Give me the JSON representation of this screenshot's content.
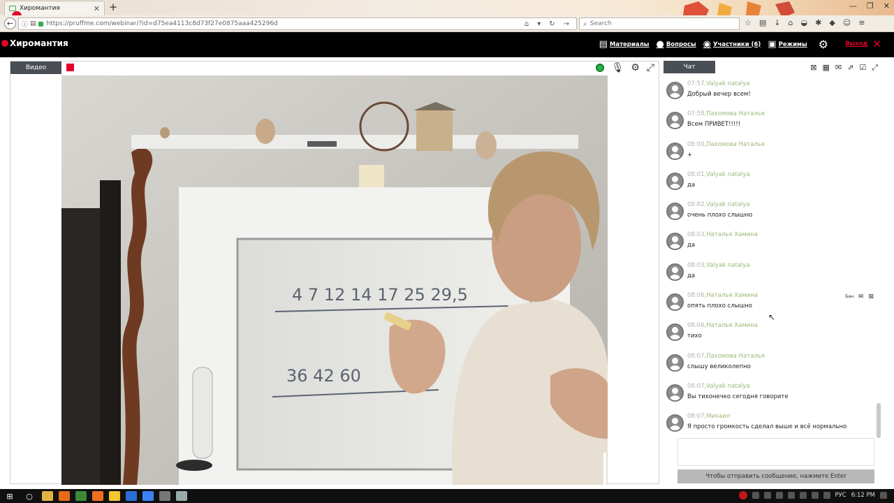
{
  "browser": {
    "tab_title": "Хиромантия",
    "tab_close": "✕",
    "new_tab": "+",
    "url": "https://pruffme.com/webinar/?id=d75ea4113c8d73f27e0875aaa425296d",
    "search_placeholder": "Search",
    "window_buttons": [
      "—",
      "❐",
      "✕"
    ]
  },
  "site": {
    "brand": "Хиромантия",
    "menu": [
      {
        "icon": "▤",
        "label": "Материалы"
      },
      {
        "icon": "●",
        "label": "Вопросы"
      },
      {
        "icon": "◉",
        "label": "Участники (6)"
      },
      {
        "icon": "▣",
        "label": "Режимы"
      }
    ],
    "settings_icon": "⚙",
    "logout_label": "Выход",
    "logout_icon": "✕"
  },
  "video": {
    "tab_label": "Видео",
    "board_row1": "4  7  12  14  17 25  29,5",
    "board_row2": "36  42  60"
  },
  "chat": {
    "tab_label": "Чат",
    "messages": [
      {
        "time": "07:57",
        "author": "Valyak natalya",
        "text": "Добрый вечер всем!"
      },
      {
        "time": "07:58",
        "author": "Пахомова Наталья",
        "text": "Всем ПРИВЕТ!!!!!"
      },
      {
        "time": "08:00",
        "author": "Пахомова Наталья",
        "text": "+"
      },
      {
        "time": "08:01",
        "author": "Valyak natalya",
        "text": "да"
      },
      {
        "time": "08:02",
        "author": "Valyak natalya",
        "text": "очень плохо слышно"
      },
      {
        "time": "08:03",
        "author": "Наталья Хамина",
        "text": "да"
      },
      {
        "time": "08:03",
        "author": "Valyak natalya",
        "text": "да"
      },
      {
        "time": "08:06",
        "author": "Наталья Хамина",
        "text": "опять плохо слышно"
      },
      {
        "time": "08:06",
        "author": "Наталья Хамина",
        "text": "тихо"
      },
      {
        "time": "08:07",
        "author": "Пахомова Наталья",
        "text": "слышу великолепно"
      },
      {
        "time": "08:07",
        "author": "Valyak natalya",
        "text": "Вы тихонечко сегодня говорите"
      },
      {
        "time": "08:07",
        "author": "Михаил",
        "text": "Я просто громкость сделал выше и всё нормально"
      }
    ],
    "ban_label": "Бан",
    "send_hint": "Чтобы отправить сообщение, нажмите Enter"
  },
  "taskbar": {
    "language": "РУС",
    "clock": "6:12 PM"
  },
  "colors": {
    "accent_red": "#e4002b",
    "tab_dark": "#4a4f56",
    "author_green": "#9cb878"
  }
}
